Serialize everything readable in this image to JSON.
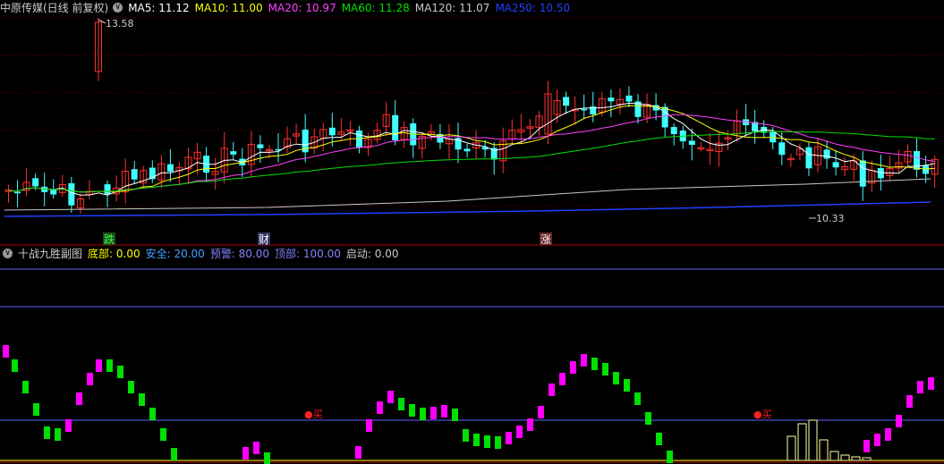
{
  "main_header": {
    "title": "中原传媒(日线 前复权)",
    "toggle_icon": "chevron-down-icon",
    "ma": [
      {
        "label": "MA5: 11.12",
        "color": "#ffffff"
      },
      {
        "label": "MA10: 11.00",
        "color": "#ffff00"
      },
      {
        "label": "MA20: 10.97",
        "color": "#ff40ff"
      },
      {
        "label": "MA60: 11.28",
        "color": "#00e000"
      },
      {
        "label": "MA120: 11.07",
        "color": "#c8c8c8"
      },
      {
        "label": "MA250: 10.50",
        "color": "#2040ff"
      }
    ]
  },
  "sub_header": {
    "title": "十战九胜副图",
    "toggle_icon": "chevron-down-icon",
    "params": [
      {
        "label": "底部: 0.00",
        "color": "#ffff00"
      },
      {
        "label": "安全: 20.00",
        "color": "#40a0ff"
      },
      {
        "label": "预警: 80.00",
        "color": "#8080ff"
      },
      {
        "label": "顶部: 100.00",
        "color": "#8080ff"
      },
      {
        "label": "启动: 0.00",
        "color": "#c8c8c8"
      }
    ]
  },
  "annotations": {
    "high_label": "13.58",
    "low_label": "10.33",
    "tags": [
      {
        "text": "跌",
        "color": "#40ff40",
        "bg": "#1a4d1a"
      },
      {
        "text": "财",
        "color": "#ffffff",
        "bg": "#333366"
      },
      {
        "text": "涨",
        "color": "#ffffff",
        "bg": "#662222"
      }
    ],
    "buy_signals": [
      "●买",
      "●买"
    ]
  },
  "colors": {
    "up_candle": "#ff3030",
    "down_candle": "#40ffff",
    "grid": "#7a0000",
    "panel_divider": "#b00000",
    "indicator_up": "#ff00ff",
    "indicator_down": "#00e000",
    "indicator_line": "#6060ff",
    "volume_bar": "#ffffa0"
  }
}
